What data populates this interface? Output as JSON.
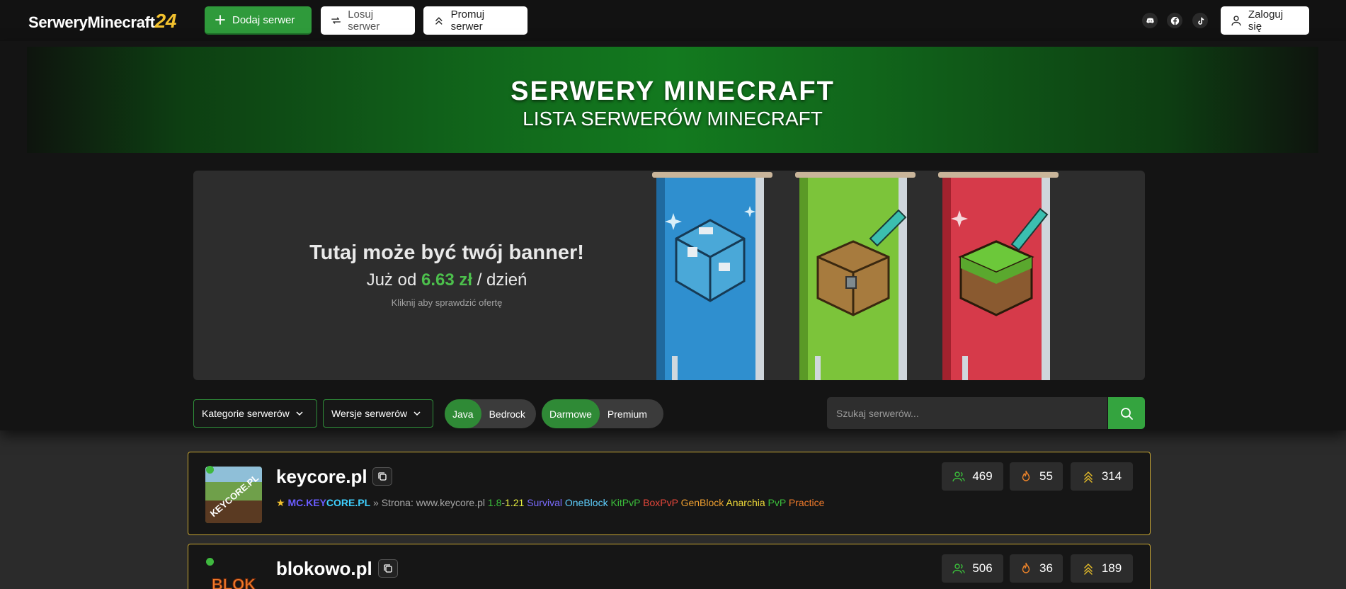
{
  "header": {
    "logo_text": "SerweryMinecraft",
    "logo_number": "24",
    "add_label": "Dodaj serwer",
    "random_label": "Losuj serwer",
    "promote_label": "Promuj serwer",
    "login_label": "Zaloguj się",
    "social_icons": [
      "discord-icon",
      "facebook-icon",
      "tiktok-icon"
    ]
  },
  "hero": {
    "title": "SERWERY MINECRAFT",
    "subtitle": "LISTA SERWERÓW MINECRAFT"
  },
  "banner": {
    "headline": "Tutaj może być twój banner!",
    "price_prefix": "Już od",
    "price": "6.63 zł",
    "price_suffix": "/ dzień",
    "note": "Kliknij aby sprawdzić ofertę"
  },
  "filters": {
    "categories_label": "Kategorie serwerów",
    "versions_label": "Wersje serwerów",
    "edition": [
      "Java",
      "Bedrock"
    ],
    "edition_selected": "Java",
    "pricing": [
      "Darmowe",
      "Premium"
    ],
    "pricing_selected": "Darmowe",
    "search_placeholder": "Szukaj serwerów..."
  },
  "servers": [
    {
      "name": "keycore.pl",
      "ip_a": "MC.KEY",
      "ip_b": "CORE.PL",
      "separator": "»",
      "site": "Strona: www.keycore.pl",
      "version_a": "1.8",
      "version_dash": "-",
      "version_b": "1.21",
      "tags": [
        "Survival",
        "OneBlock",
        "KitPvP",
        "BoxPvP",
        "GenBlock",
        "Anarchia",
        "PvP",
        "Practice"
      ],
      "tag_colors": [
        "#7b6cff",
        "#5fd0ff",
        "#3bbf3b",
        "#e8473b",
        "#f0a030",
        "#f2dc3a",
        "#3bbf3b",
        "#f07a2a"
      ],
      "players": "469",
      "fire": "55",
      "votes": "314",
      "thumb_text": "KEYCORE.PL"
    },
    {
      "name": "blokowo.pl",
      "players": "506",
      "fire": "36",
      "votes": "189",
      "thumb_text": "BLOK"
    }
  ],
  "colors": {
    "accent_green": "#2f9a3b",
    "card_border": "#c9a733",
    "logo_yellow": "#f2c12e"
  }
}
